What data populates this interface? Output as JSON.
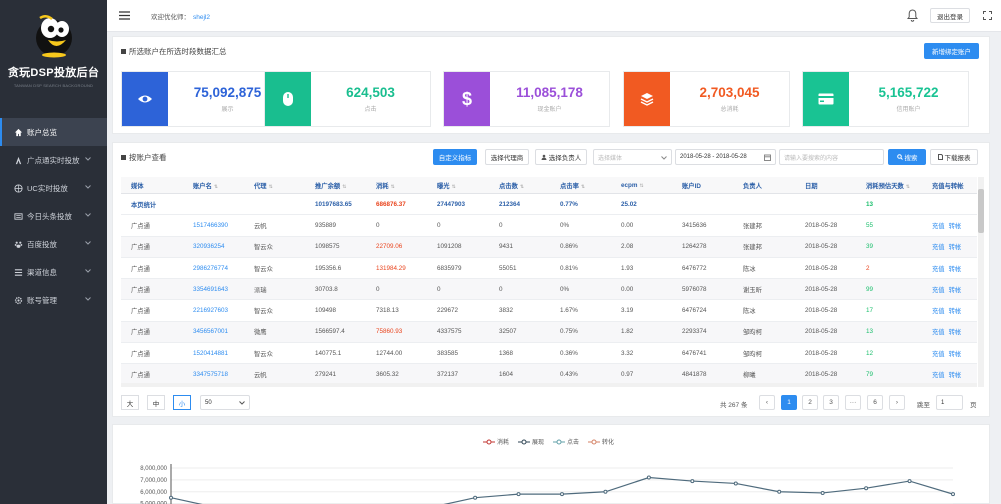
{
  "sidebar": {
    "title": "贪玩DSP投放后台",
    "subtitle": "TANWAN DSP SEARCH BACKGROUND",
    "items": [
      {
        "label": "账户总览",
        "icon": "home-icon",
        "active": true,
        "caret": false
      },
      {
        "label": "广点通实时投放",
        "icon": "badge-icon",
        "active": false,
        "caret": true
      },
      {
        "label": "UC实时投放",
        "icon": "globe-icon",
        "active": false,
        "caret": true
      },
      {
        "label": "今日头条投放",
        "icon": "newspaper-icon",
        "active": false,
        "caret": true
      },
      {
        "label": "百度投放",
        "icon": "paw-icon",
        "active": false,
        "caret": true
      },
      {
        "label": "渠道信息",
        "icon": "grid-icon",
        "active": false,
        "caret": true
      },
      {
        "label": "账号管理",
        "icon": "gear-icon",
        "active": false,
        "caret": true
      }
    ]
  },
  "header": {
    "welcome": "欢迎优化师：",
    "username": "shejl2",
    "logout": "退出登录"
  },
  "summary": {
    "title": "所选账户在所选时段数据汇总",
    "add_button": "新增绑定账户",
    "stats": [
      {
        "value": "75,092,875",
        "label": "展示",
        "color": "#2d63d8",
        "icon": "eye-icon"
      },
      {
        "value": "624,503",
        "label": "点击",
        "color": "#19be8f",
        "icon": "mouse-icon"
      },
      {
        "value": "11,085,178",
        "label": "现金账户",
        "color": "#9b4fd9",
        "icon": "dollar-icon"
      },
      {
        "value": "2,703,045",
        "label": "总消耗",
        "color": "#f15a22",
        "icon": "layers-icon"
      },
      {
        "value": "5,165,722",
        "label": "信用账户",
        "color": "#19c393",
        "icon": "card-icon"
      }
    ]
  },
  "accounts": {
    "title": "按账户查看",
    "custom_metrics": "自定义指标",
    "select_agent": "选择代理商",
    "select_owner": "选择负责人",
    "media_placeholder": "选择媒体",
    "date_range": "2018-05-28 - 2018-05-28",
    "search_placeholder": "请输入要搜索的内容",
    "search_button": "搜索",
    "download_button": "下载报表",
    "columns": [
      "媒体",
      "账户名",
      "代理",
      "推广余额",
      "消耗",
      "曝光",
      "点击数",
      "点击率",
      "ecpm",
      "账户ID",
      "负责人",
      "日期",
      "消耗预估天数",
      "充值与转帐"
    ],
    "summary_row": [
      "本页统计",
      "",
      "",
      "10197683.65",
      "686876.37",
      "27447903",
      "212364",
      "0.77%",
      "25.02",
      "",
      "",
      "",
      "13",
      ""
    ],
    "rows": [
      [
        "广点通",
        "1517466390",
        "云帆",
        "935889",
        "0",
        "0",
        "0",
        "0%",
        "0.00",
        "3415636",
        "张建邦",
        "2018-05-28",
        "55"
      ],
      [
        "广点通",
        "320936254",
        "智云众",
        "1098575",
        "22709.06",
        "1091208",
        "9431",
        "0.86%",
        "2.08",
        "1264278",
        "张建邦",
        "2018-05-28",
        "39"
      ],
      [
        "广点通",
        "2986276774",
        "智云众",
        "195356.6",
        "131984.29",
        "6835979",
        "55051",
        "0.81%",
        "1.93",
        "6476772",
        "陈冰",
        "2018-05-28",
        "2"
      ],
      [
        "广点通",
        "3354691643",
        "派瑞",
        "30703.8",
        "0",
        "0",
        "0",
        "0%",
        "0.00",
        "5976078",
        "谢玉昕",
        "2018-05-28",
        "99"
      ],
      [
        "广点通",
        "2216927603",
        "智云众",
        "109498",
        "7318.13",
        "229672",
        "3832",
        "1.67%",
        "3.19",
        "6476724",
        "陈冰",
        "2018-05-28",
        "17"
      ],
      [
        "广点通",
        "3456567001",
        "微鹰",
        "1566597.4",
        "75860.93",
        "4337575",
        "32507",
        "0.75%",
        "1.82",
        "2293374",
        "邹昀柯",
        "2018-05-28",
        "13"
      ],
      [
        "广点通",
        "1520414881",
        "智云众",
        "140775.1",
        "12744.00",
        "383585",
        "1368",
        "0.36%",
        "3.32",
        "6476741",
        "邹昀柯",
        "2018-05-28",
        "12"
      ],
      [
        "广点通",
        "3347575718",
        "云帆",
        "279241",
        "3605.32",
        "372137",
        "1604",
        "0.43%",
        "0.97",
        "4841878",
        "柳曦",
        "2018-05-28",
        "79"
      ]
    ],
    "red_cells": [
      [
        2,
        1
      ],
      [
        3,
        2
      ],
      [
        6,
        5
      ]
    ],
    "red_est": [
      2
    ],
    "actions": [
      "充值",
      "转帐"
    ]
  },
  "pagination": {
    "sizes": [
      "大",
      "中",
      "小"
    ],
    "page_size": "50",
    "total": "共 267 条",
    "pages": [
      "1",
      "2",
      "3",
      "···",
      "6"
    ],
    "current": "1",
    "jump_label": "跳至",
    "jump_value": "1",
    "page_suffix": "页"
  },
  "chart_data": {
    "type": "line",
    "legend": [
      "消耗",
      "展现",
      "点击",
      "转化"
    ],
    "y_ticks": [
      "8,000,000",
      "7,000,000",
      "6,000,000",
      "5,000,000"
    ],
    "ylim": [
      5000000,
      8000000
    ],
    "series": [
      {
        "name": "展现",
        "color": "#4f6b7d",
        "values": [
          5500000,
          4700000,
          4500000,
          4400000,
          4400000,
          4500000,
          4700000,
          5500000,
          5800000,
          5800000,
          6000000,
          7200000,
          6900000,
          6700000,
          6000000,
          5900000,
          6300000,
          6900000,
          5800000
        ]
      }
    ]
  }
}
